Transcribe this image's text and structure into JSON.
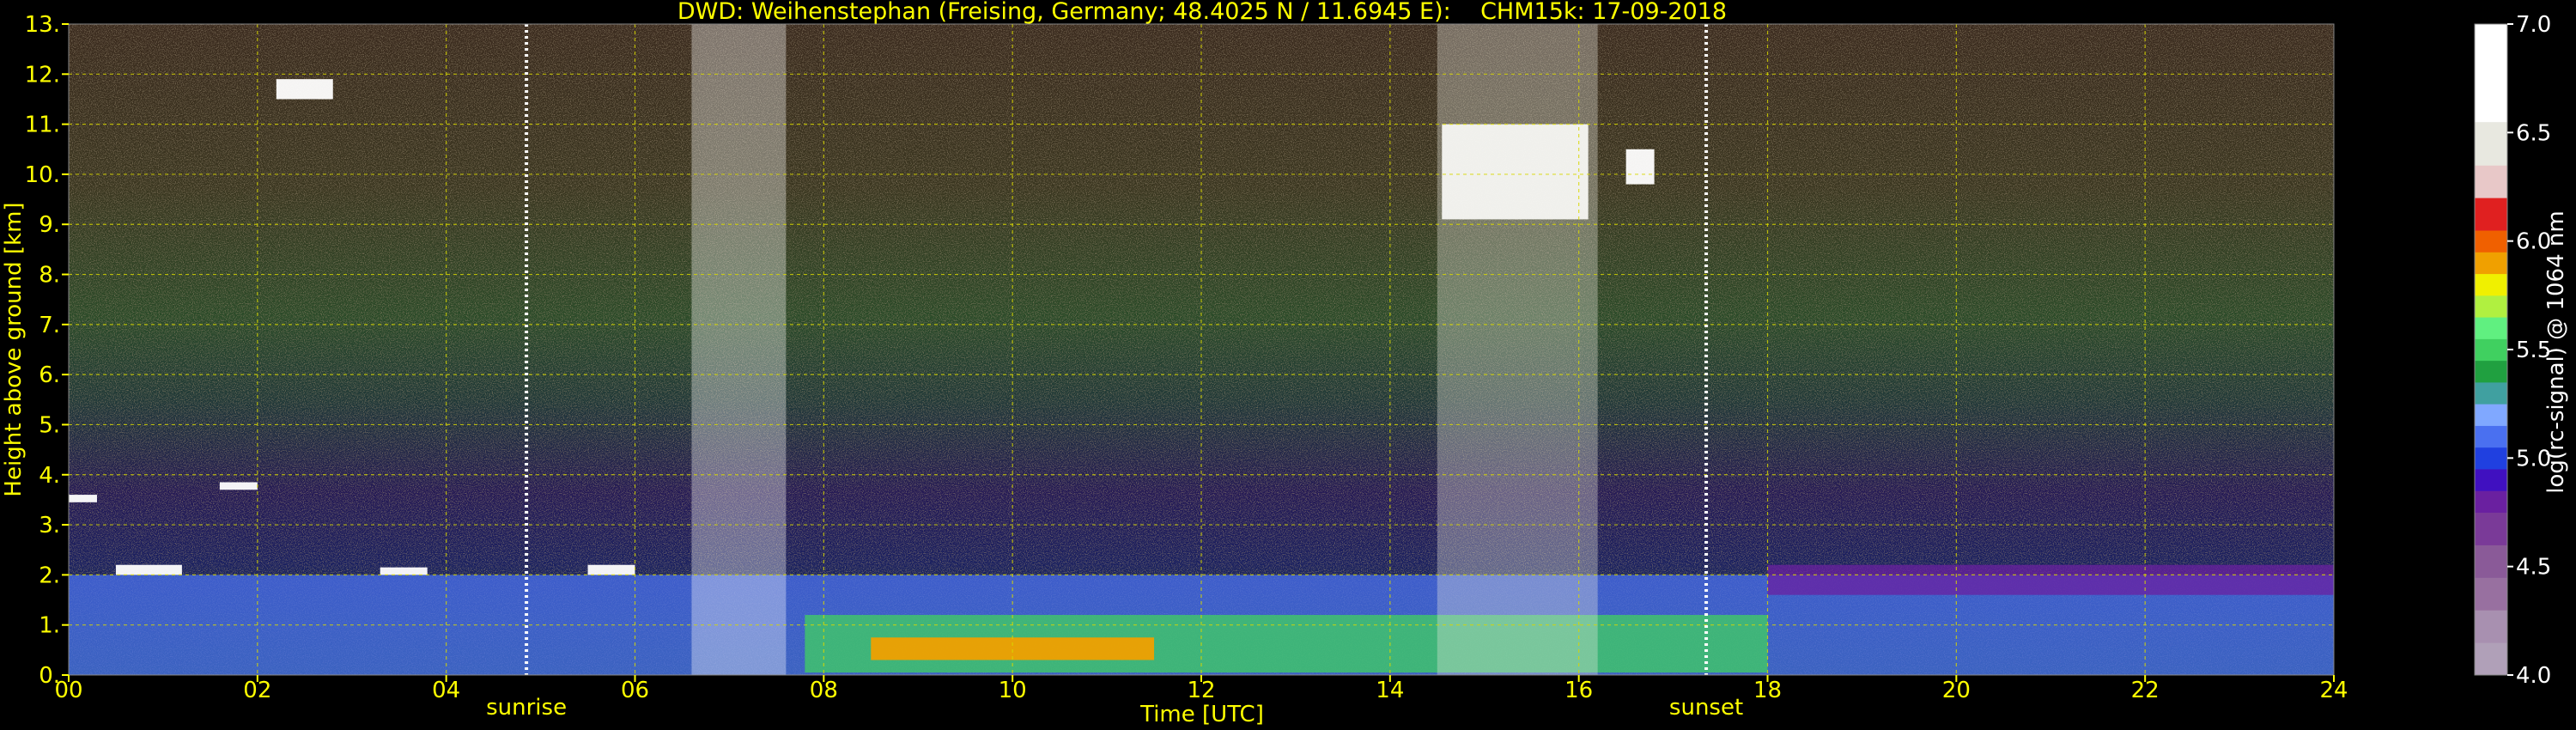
{
  "chart_data": {
    "type": "heatmap",
    "title": "DWD: Weihenstephan (Freising, Germany; 48.4025 N / 11.6945 E):    CHM15k: 17-09-2018",
    "xlabel": "Time [UTC]",
    "ylabel": "Height above ground [km]",
    "xlim": [
      0,
      24
    ],
    "ylim": [
      0,
      13
    ],
    "x_ticks": [
      0,
      2,
      4,
      6,
      8,
      10,
      12,
      14,
      16,
      18,
      20,
      22,
      24
    ],
    "x_tick_labels": [
      "00",
      "02",
      "04",
      "06",
      "08",
      "10",
      "12",
      "14",
      "16",
      "18",
      "20",
      "22",
      "24"
    ],
    "y_ticks": [
      0,
      1,
      2,
      3,
      4,
      5,
      6,
      7,
      8,
      9,
      10,
      11,
      12,
      13
    ],
    "y_tick_labels": [
      "0.",
      "1.",
      "2.",
      "3.",
      "4.",
      "5.",
      "6.",
      "7.",
      "8.",
      "9.",
      "10.",
      "11.",
      "12.",
      "13."
    ],
    "grid": true,
    "markers": [
      {
        "label": "sunrise",
        "time": 4.85
      },
      {
        "label": "sunset",
        "time": 17.35
      }
    ],
    "colorbar": {
      "label": "log(rc-signal) @ 1064 nm",
      "range": [
        4.0,
        7.0
      ],
      "ticks": [
        4.0,
        4.5,
        5.0,
        5.5,
        6.0,
        6.5,
        7.0
      ],
      "tick_labels": [
        "4.0",
        "4.5",
        "5.0",
        "5.5",
        "6.0",
        "6.5",
        "7.0"
      ],
      "bands": [
        {
          "from": 4.0,
          "to": 4.15,
          "color": "#b0a0b8"
        },
        {
          "from": 4.15,
          "to": 4.3,
          "color": "#a890b0"
        },
        {
          "from": 4.3,
          "to": 4.45,
          "color": "#9870a0"
        },
        {
          "from": 4.45,
          "to": 4.6,
          "color": "#8a5a98"
        },
        {
          "from": 4.6,
          "to": 4.75,
          "color": "#7a3a98"
        },
        {
          "from": 4.75,
          "to": 4.85,
          "color": "#6a20a0"
        },
        {
          "from": 4.85,
          "to": 4.95,
          "color": "#4010c0"
        },
        {
          "from": 4.95,
          "to": 5.05,
          "color": "#2040e0"
        },
        {
          "from": 5.05,
          "to": 5.15,
          "color": "#4a70f0"
        },
        {
          "from": 5.15,
          "to": 5.25,
          "color": "#80a8ff"
        },
        {
          "from": 5.25,
          "to": 5.35,
          "color": "#40a0a0"
        },
        {
          "from": 5.35,
          "to": 5.45,
          "color": "#20a040"
        },
        {
          "from": 5.45,
          "to": 5.55,
          "color": "#40d060"
        },
        {
          "from": 5.55,
          "to": 5.65,
          "color": "#60f080"
        },
        {
          "from": 5.65,
          "to": 5.75,
          "color": "#b0f040"
        },
        {
          "from": 5.75,
          "to": 5.85,
          "color": "#f0f000"
        },
        {
          "from": 5.85,
          "to": 5.95,
          "color": "#f0a000"
        },
        {
          "from": 5.95,
          "to": 6.05,
          "color": "#f06000"
        },
        {
          "from": 6.05,
          "to": 6.2,
          "color": "#e02020"
        },
        {
          "from": 6.2,
          "to": 6.35,
          "color": "#e8c8c8"
        },
        {
          "from": 6.35,
          "to": 6.55,
          "color": "#e8e8e0"
        },
        {
          "from": 6.55,
          "to": 7.0,
          "color": "#ffffff"
        }
      ]
    },
    "features": [
      {
        "name": "aerosol-layer",
        "t_start": 0,
        "t_end": 24,
        "h_bottom": 0.0,
        "h_top": 2.0,
        "value": 5.1
      },
      {
        "name": "surface-green-layer",
        "t_start": 7.8,
        "t_end": 18,
        "h_bottom": 0.05,
        "h_top": 1.2,
        "value": 5.55
      },
      {
        "name": "orange-patch",
        "t_start": 8.5,
        "t_end": 11.5,
        "h_bottom": 0.3,
        "h_top": 0.75,
        "value": 5.9
      },
      {
        "name": "residual-layer-purple",
        "t_start": 18,
        "t_end": 24,
        "h_bottom": 1.6,
        "h_top": 2.2,
        "value": 4.8
      },
      {
        "name": "cirrus-cloud",
        "t_start": 14.55,
        "t_end": 16.1,
        "h_bottom": 9.1,
        "h_top": 11.0,
        "value": 7.0
      },
      {
        "name": "cloud-streak",
        "t_start": 16.5,
        "t_end": 16.8,
        "h_bottom": 9.8,
        "h_top": 10.5,
        "value": 6.8
      },
      {
        "name": "high-cloud",
        "t_start": 2.2,
        "t_end": 2.8,
        "h_bottom": 11.5,
        "h_top": 11.9,
        "value": 6.9
      },
      {
        "name": "cloud-base",
        "t_start": 0.0,
        "t_end": 0.3,
        "h_bottom": 3.45,
        "h_top": 3.6,
        "value": 7.0
      },
      {
        "name": "cloud-base",
        "t_start": 1.6,
        "t_end": 2.0,
        "h_bottom": 3.7,
        "h_top": 3.85,
        "value": 7.0
      },
      {
        "name": "cloud-top-2km",
        "t_start": 0.5,
        "t_end": 1.2,
        "h_bottom": 2.0,
        "h_top": 2.2,
        "value": 7.0
      },
      {
        "name": "cloud-top-2km",
        "t_start": 3.3,
        "t_end": 3.8,
        "h_bottom": 2.0,
        "h_top": 2.15,
        "value": 7.0
      },
      {
        "name": "cloud-top-2km",
        "t_start": 5.5,
        "t_end": 6.0,
        "h_bottom": 2.0,
        "h_top": 2.2,
        "value": 7.0
      },
      {
        "name": "precip-column",
        "t_start": 6.6,
        "t_end": 7.6,
        "h_bottom": 0.0,
        "h_top": 13.0,
        "value": 6.7
      },
      {
        "name": "precip-column",
        "t_start": 14.5,
        "t_end": 16.2,
        "h_bottom": 0.0,
        "h_top": 13.0,
        "value": 6.4
      }
    ]
  }
}
